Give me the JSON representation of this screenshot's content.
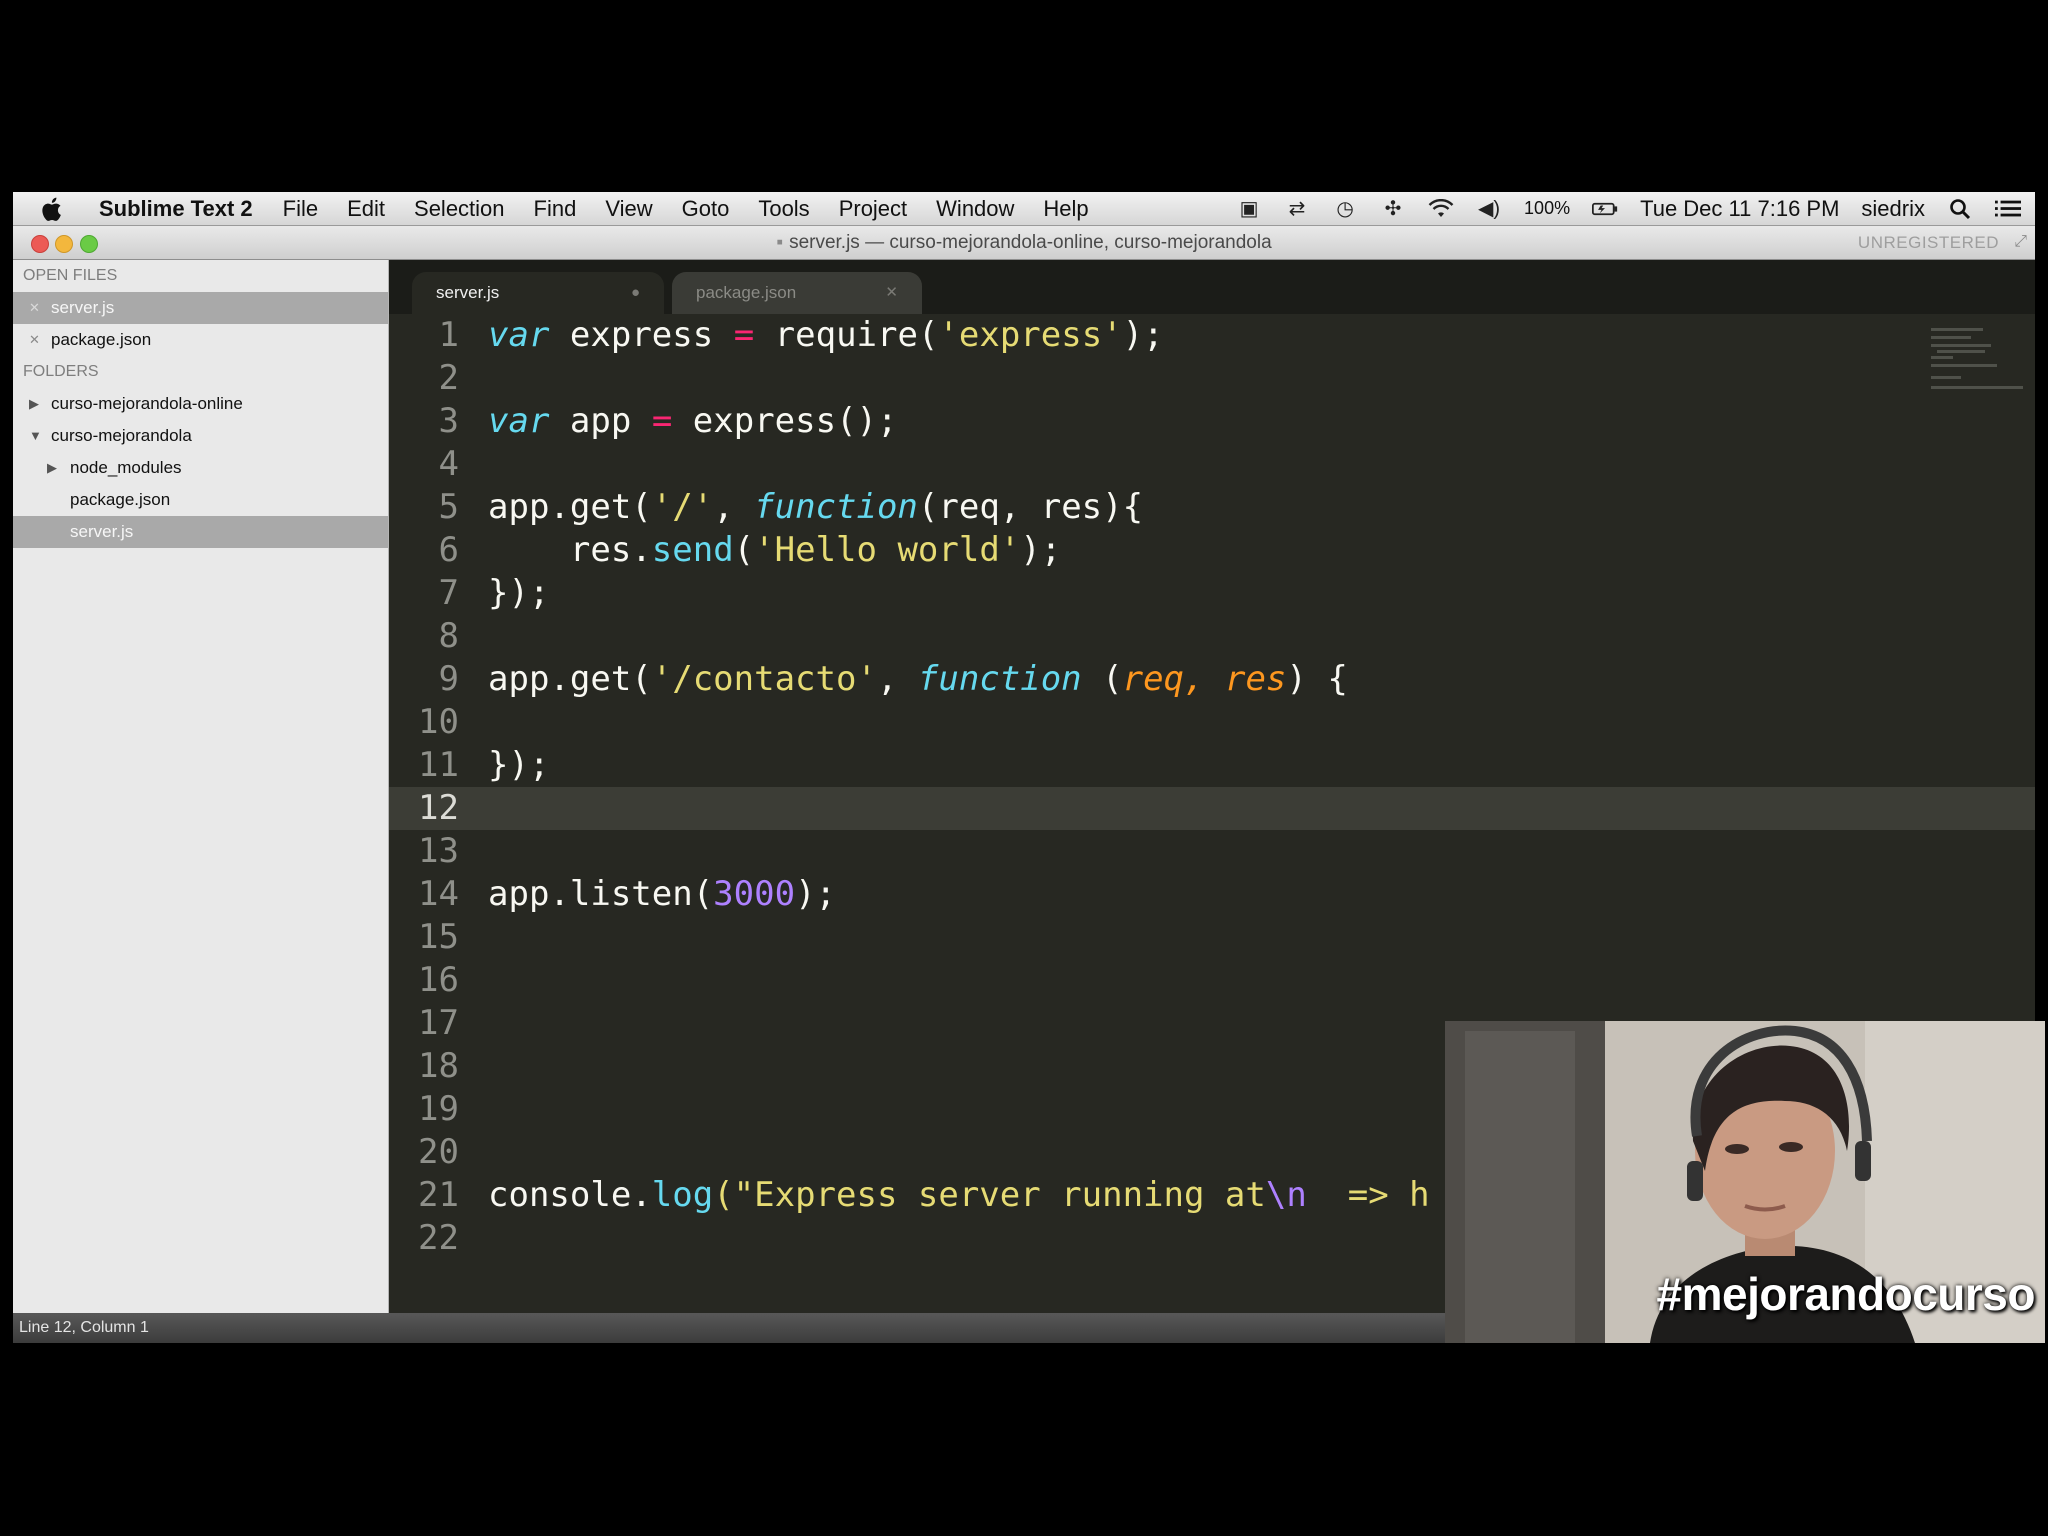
{
  "menubar": {
    "app_name": "Sublime Text 2",
    "items": [
      "File",
      "Edit",
      "Selection",
      "Find",
      "View",
      "Goto",
      "Tools",
      "Project",
      "Window",
      "Help"
    ],
    "battery": "100%",
    "datetime": "Tue Dec 11  7:16 PM",
    "user": "siedrix"
  },
  "window": {
    "title": "server.js — curso-mejorandola-online, curso-mejorandola",
    "unregistered": "UNREGISTERED"
  },
  "sidebar": {
    "open_files_heading": "OPEN FILES",
    "open_files": [
      "server.js",
      "package.json"
    ],
    "folders_heading": "FOLDERS",
    "folders": [
      "curso-mejorandola-online",
      "curso-mejorandola",
      "node_modules",
      "package.json",
      "server.js"
    ]
  },
  "tabs": [
    "server.js",
    "package.json"
  ],
  "editor": {
    "line_numbers": [
      "1",
      "2",
      "3",
      "4",
      "5",
      "6",
      "7",
      "8",
      "9",
      "10",
      "11",
      "12",
      "13",
      "14",
      "15",
      "16",
      "17",
      "18",
      "19",
      "20",
      "21",
      "22"
    ],
    "current_line": 12,
    "tokens": {
      "var": "var",
      "express_id": "express",
      "eq": "=",
      "require": "require(",
      "express_str": "'express'",
      "close_semi": ");",
      "app_id": "app",
      "express_call": "express();",
      "app_get": "app.get(",
      "slash_str": "'/'",
      "comma": ", ",
      "function": "function",
      "req_res_open": "(req, res){",
      "res_dot": "res.",
      "send": "send",
      "paren_open": "(",
      "hello_str": "'Hello world'",
      "close_block": "});",
      "contacto_str": "'/contacto'",
      "space_paren": " (",
      "req": "req,",
      "res": "res",
      "paren_brace": ") {",
      "listen": "app.listen(",
      "port": "3000",
      "console": "console.",
      "log": "log",
      "log_str": "(\"Express server running at",
      "newline_esc": "\\n",
      "arrow": "  => h"
    }
  },
  "statusbar": {
    "position": "Line 12, Column 1"
  },
  "webcam": {
    "hashtag": "#mejorandocurso"
  }
}
